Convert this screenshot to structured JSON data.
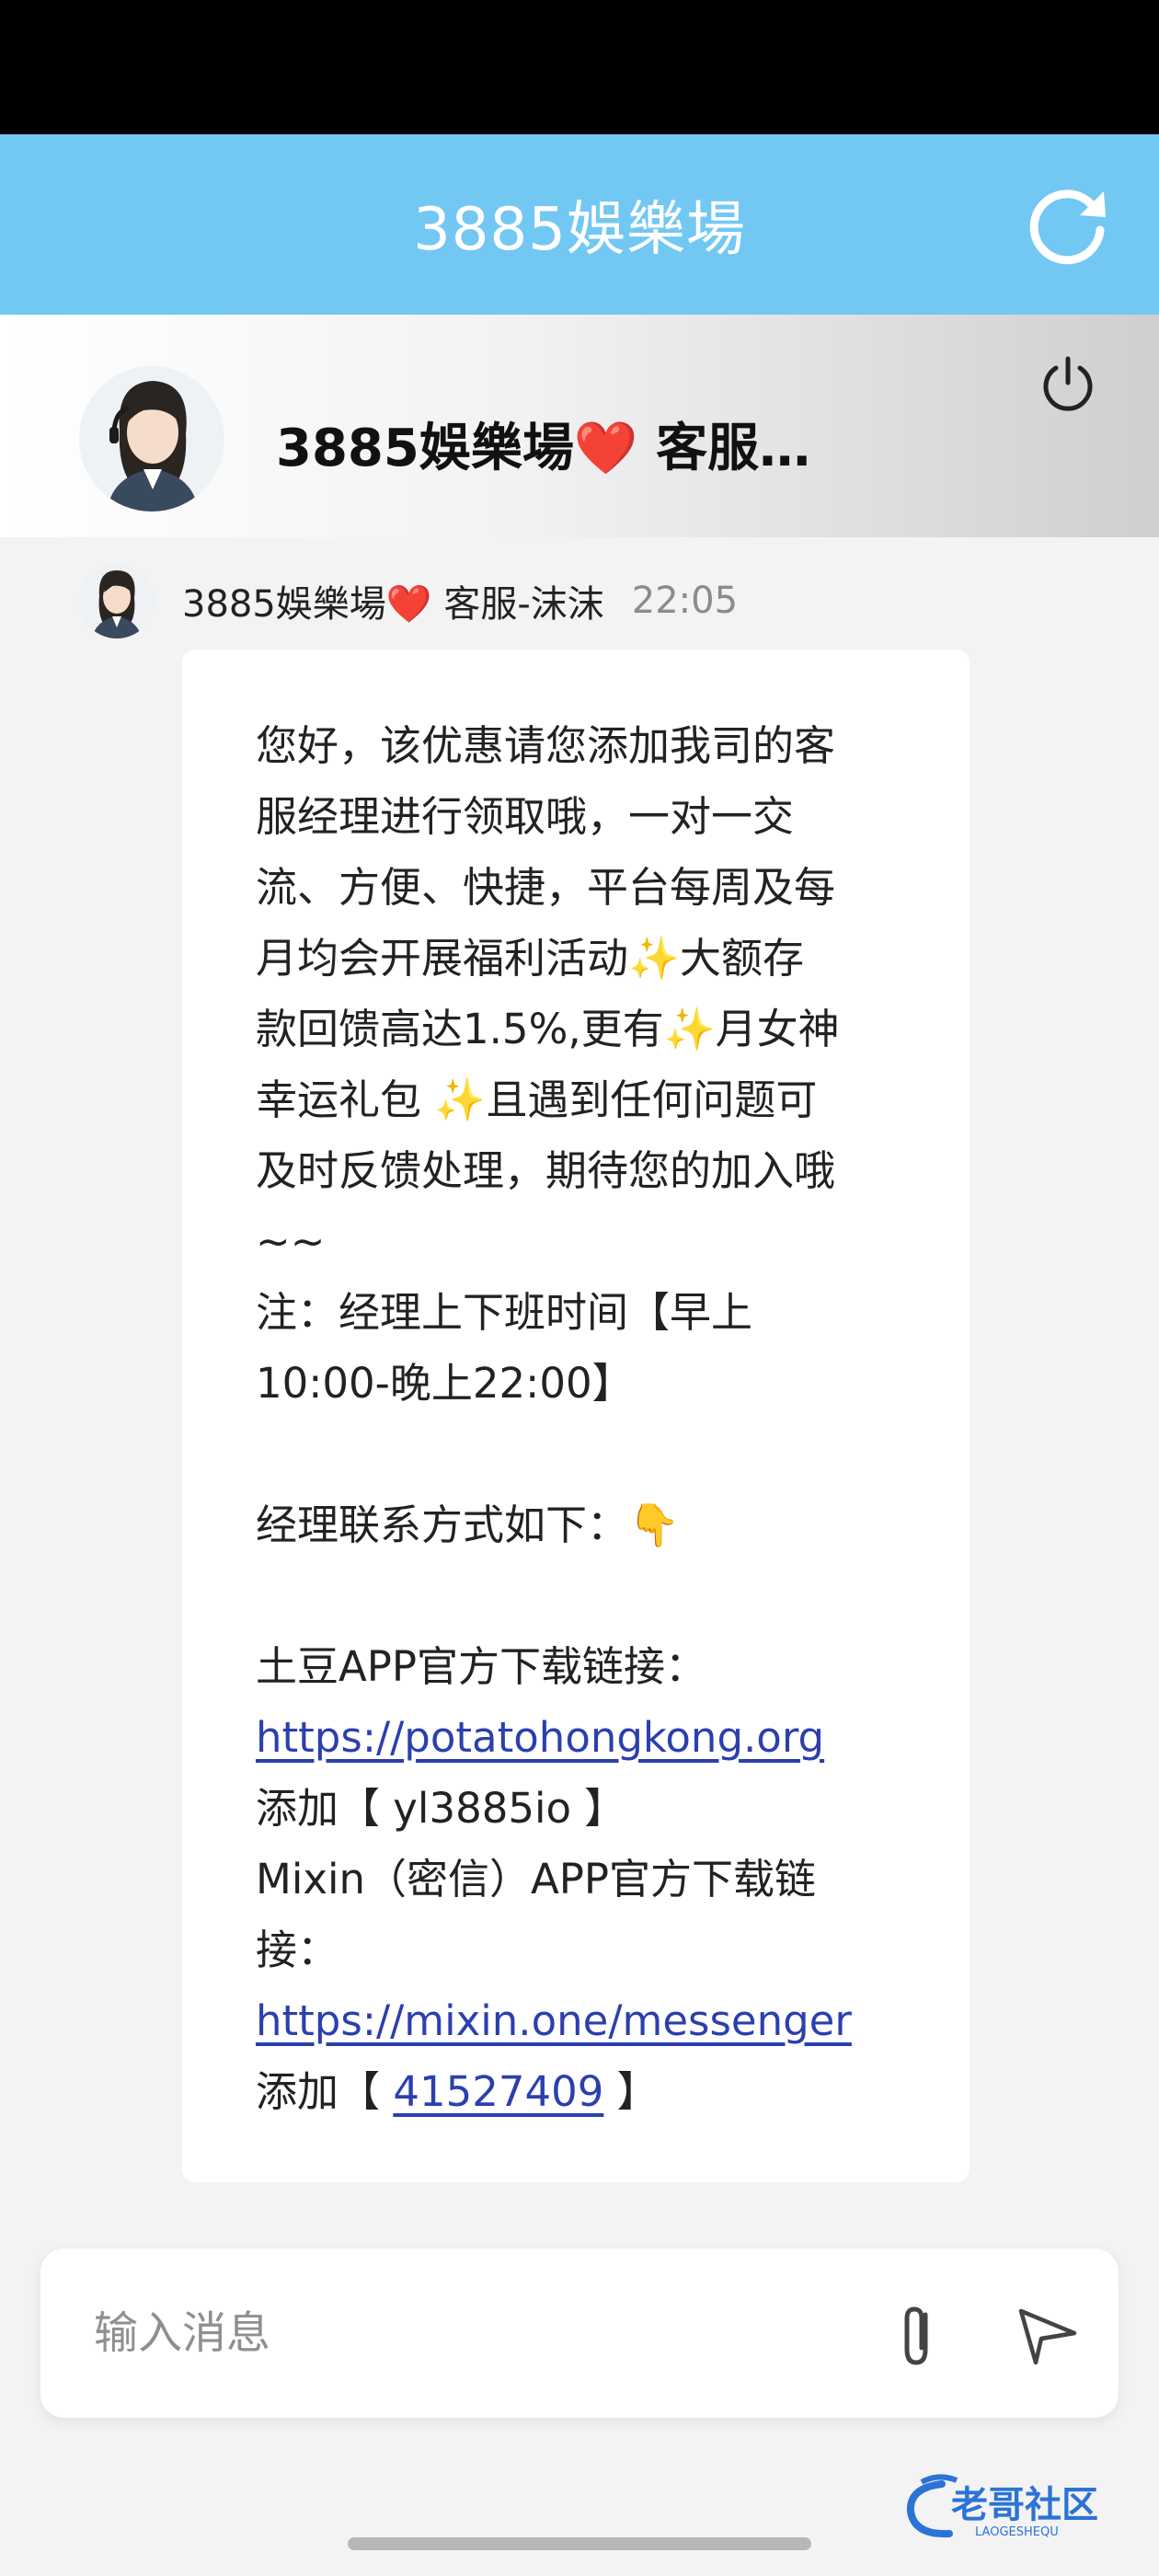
{
  "header": {
    "title": "3885娛樂場"
  },
  "agent": {
    "name": "3885娛樂場❤️ 客服…"
  },
  "message": {
    "sender": "3885娛樂場❤️ 客服-沫沫",
    "time": "22:05",
    "lines": [
      "您好，该优惠请您添加我司的客",
      "服经理进行领取哦，一对一交",
      "流、方便、快捷，平台每周及每",
      "月均会开展福利活动✨大额存",
      "款回馈高达1.5%,更有✨月女神",
      "幸运礼包 ✨且遇到任何问题可",
      "及时反馈处理，期待您的加入哦",
      "~~",
      "注：经理上下班时间【早上",
      "10:00-晚上22:00】",
      "",
      "经理联系方式如下：👇",
      "",
      "土豆APP官方下载链接：",
      "https://potatohongkong.org",
      "添加【 yl3885io 】",
      "Mixin（密信）APP官方下载链",
      "接：",
      "https://mixin.one/messenger",
      "添加【 41527409 】"
    ],
    "add_prefix": "添加【 ",
    "add_suffix": " 】",
    "mixin_id": "41527409"
  },
  "input": {
    "placeholder": "输入消息"
  },
  "watermark": {
    "text": "老哥社区",
    "subtext": "LAOGESHEQU"
  },
  "colors": {
    "header_bg": "#72c8f3",
    "link": "#2c3fae",
    "time": "#8b8b8b"
  },
  "icons": [
    "refresh-icon",
    "power-icon",
    "attach-icon",
    "send-icon"
  ]
}
